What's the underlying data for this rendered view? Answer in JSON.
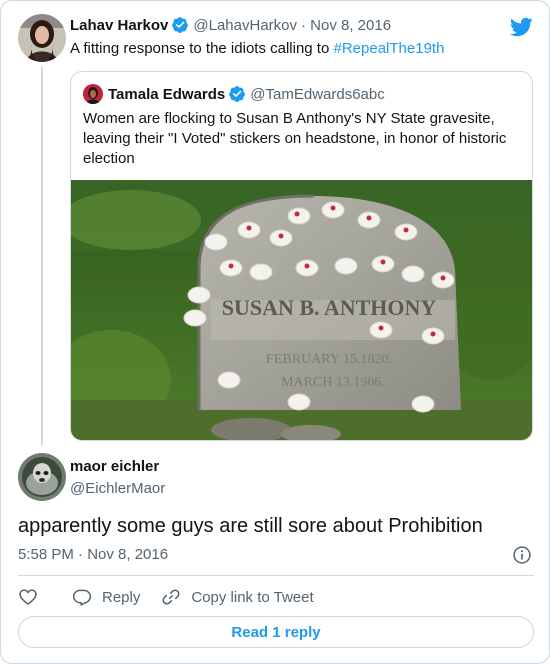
{
  "parent": {
    "name": "Lahav Harkov",
    "handle": "@LahavHarkov",
    "date": "· Nov 8, 2016",
    "text_prefix": "A fitting response to the idiots calling to ",
    "hashtag": "#RepealThe19th"
  },
  "quoted": {
    "name": "Tamala Edwards",
    "handle": "@TamEdwards6abc",
    "text": "Women are flocking to Susan B Anthony's NY State gravesite, leaving their \"I Voted\" stickers on headstone, in honor of historic election",
    "headstone_line1": "SUSAN B. ANTHONY",
    "headstone_line2": "FEBRUARY 15.1820.",
    "headstone_line3": "MARCH 13.1906."
  },
  "reply": {
    "name": "maor eichler",
    "handle": "@EichlerMaor",
    "text": "apparently some guys are still sore about Prohibition",
    "timestamp": "5:58 PM · Nov 8, 2016"
  },
  "actions": {
    "reply_label": "Reply",
    "copy_label": "Copy link to Tweet",
    "read_replies_label": "Read 1 reply"
  },
  "colors": {
    "accent": "#1d9bf0",
    "muted": "#536471",
    "border": "#cfd9de"
  },
  "icons": [
    "verified-badge-icon",
    "twitter-bird-icon",
    "info-icon",
    "heart-icon",
    "reply-icon",
    "link-icon"
  ]
}
